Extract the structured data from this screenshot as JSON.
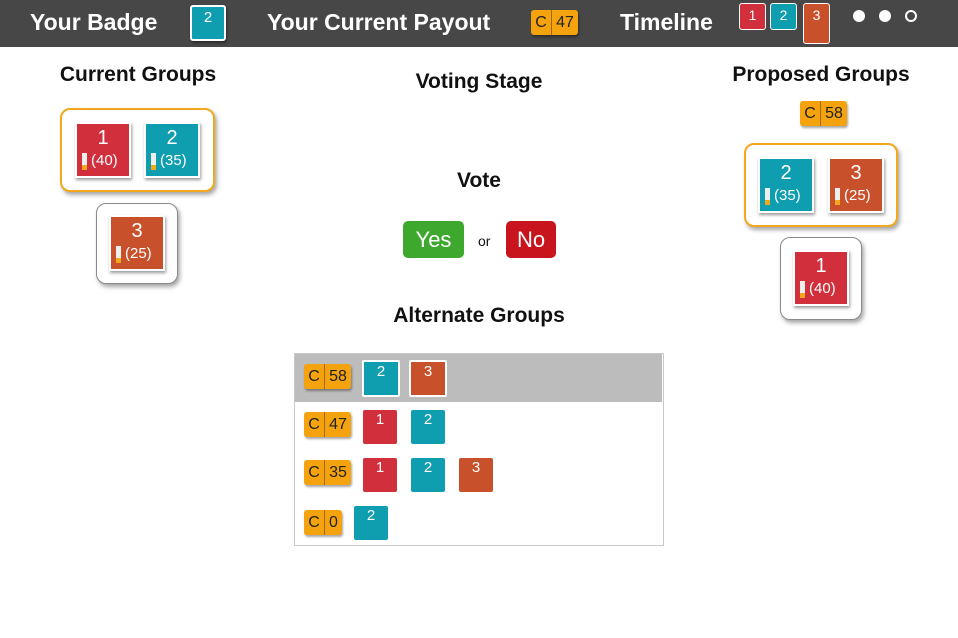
{
  "topbar": {
    "badge_label": "Your Badge",
    "badge_value": "2",
    "payout_label": "Your Current Payout",
    "payout_currency": "C",
    "payout_value": "47",
    "timeline_label": "Timeline",
    "timeline_items": [
      "1",
      "2",
      "3"
    ],
    "progress_dots": {
      "total": 3,
      "completed": 2
    }
  },
  "current_groups": {
    "title": "Current Groups",
    "groups": [
      {
        "members": [
          {
            "id": "1",
            "score": "(40)",
            "color": "#d22f3c"
          },
          {
            "id": "2",
            "score": "(35)",
            "color": "#0f9db0"
          }
        ]
      },
      {
        "members": [
          {
            "id": "3",
            "score": "(25)",
            "color": "#c8512c"
          }
        ]
      }
    ]
  },
  "voting": {
    "stage_title": "Voting Stage",
    "vote_title": "Vote",
    "yes_label": "Yes",
    "or_label": "or",
    "no_label": "No"
  },
  "proposed_groups": {
    "title": "Proposed Groups",
    "currency": "C",
    "payout": "58",
    "groups": [
      {
        "members": [
          {
            "id": "2",
            "score": "(35)",
            "color": "#0f9db0"
          },
          {
            "id": "3",
            "score": "(25)",
            "color": "#c8512c"
          }
        ]
      },
      {
        "members": [
          {
            "id": "1",
            "score": "(40)",
            "color": "#d22f3c"
          }
        ]
      }
    ]
  },
  "alternate_groups": {
    "title": "Alternate Groups",
    "rows": [
      {
        "currency": "C",
        "payout": "58",
        "members": [
          "2",
          "3"
        ],
        "selected": true
      },
      {
        "currency": "C",
        "payout": "47",
        "members": [
          "1",
          "2"
        ],
        "selected": false
      },
      {
        "currency": "C",
        "payout": "35",
        "members": [
          "1",
          "2",
          "3"
        ],
        "selected": false
      },
      {
        "currency": "C",
        "payout": "0",
        "members": [
          "2"
        ],
        "selected": false
      }
    ]
  },
  "colors": {
    "red": "#d22f3c",
    "teal": "#0f9db0",
    "orange": "#c8512c",
    "gold": "#f4a20e",
    "yes": "#3ea82e",
    "no": "#c8141d",
    "topbar": "#474747"
  }
}
